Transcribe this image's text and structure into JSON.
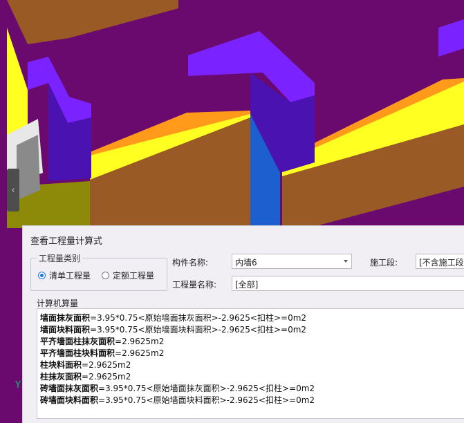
{
  "dialog": {
    "title": "查看工程量计算式",
    "quantity_type_group": {
      "legend": "工程量类别",
      "options": [
        {
          "label": "清单工程量",
          "selected": true
        },
        {
          "label": "定额工程量",
          "selected": false
        }
      ]
    },
    "component_name_label": "构件名称:",
    "component_name_value": "内墙6",
    "construction_stage_label": "施工段:",
    "construction_stage_value": "[不含施工段]",
    "quantity_name_label": "工程量名称:",
    "quantity_name_value": "[全部]",
    "calc_group_legend": "计算机算量",
    "calc_lines": [
      {
        "name": "墙面抹灰面积",
        "expr": "=3.95*0.75<原始墙面抹灰面积>-2.9625<扣柱>=0m2"
      },
      {
        "name": "墙面块料面积",
        "expr": "=3.95*0.75<原始墙面块料面积>-2.9625<扣柱>=0m2"
      },
      {
        "name": "平齐墙面柱抹灰面积",
        "expr": "=2.9625m2"
      },
      {
        "name": "平齐墙面柱块料面积",
        "expr": "=2.9625m2"
      },
      {
        "name": "柱块料面积",
        "expr": "=2.9625m2"
      },
      {
        "name": "柱抹灰面积",
        "expr": "=2.9625m2"
      },
      {
        "name": "砖墙面抹灰面积",
        "expr": "=3.95*0.75<原始墙面抹灰面积>-2.9625<扣柱>=0m2"
      },
      {
        "name": "砖墙面块料面积",
        "expr": "=3.95*0.75<原始墙面块料面积>-2.9625<扣柱>=0m2"
      }
    ]
  },
  "viewport": {
    "collapse_icon": "‹",
    "axis_label": "Y",
    "colors": {
      "floor": "#6a0a6e",
      "wall_brown": "#9a5a26",
      "wall_top": "#7a22ff",
      "wall_side": "#4a12b0",
      "yellow": "#ffff22",
      "orange": "#ff9a1a",
      "olive": "#8c8a08",
      "blue": "#1e5fd0"
    }
  }
}
